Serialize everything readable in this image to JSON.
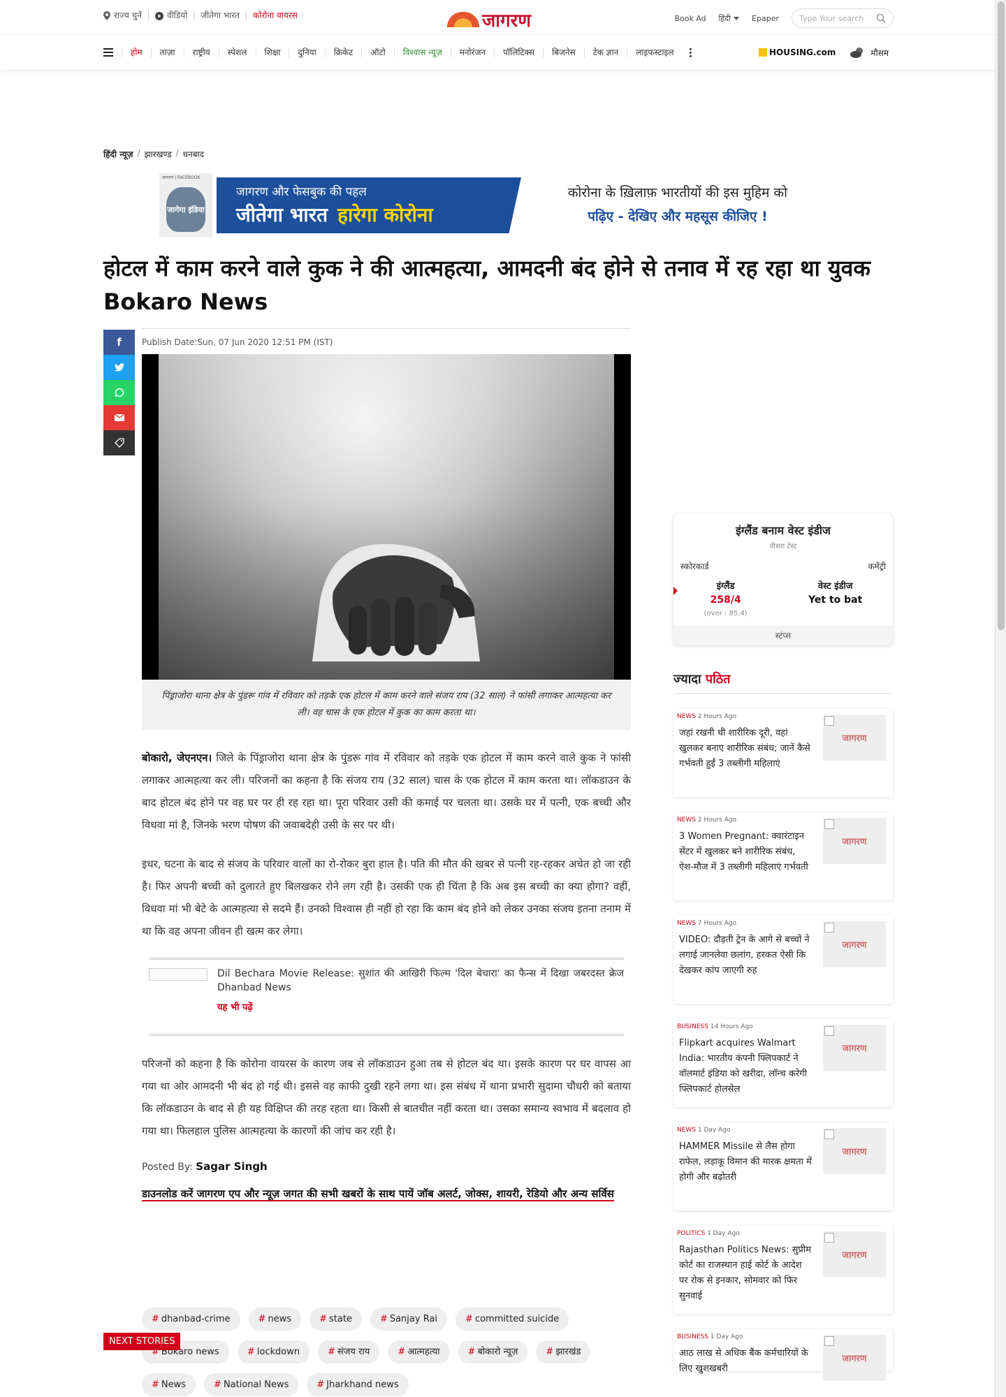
{
  "topbar": {
    "links": [
      {
        "label": "राज्य चुनें",
        "icon": "location-pin-icon"
      },
      {
        "label": "वीडियो",
        "icon": "play-circle-icon"
      },
      {
        "label": "जीतेगा भारत",
        "icon": ""
      },
      {
        "label": "कोरोना वायरस",
        "icon": ""
      }
    ],
    "logo_text": "जागरण",
    "book_ad": "Book Ad",
    "language": "हिंदी",
    "epaper": "Epaper",
    "search_placeholder": "Type Your search"
  },
  "nav": {
    "items": [
      "होम",
      "ताज़ा",
      "राष्ट्रीय",
      "स्पेशल",
      "शिक्षा",
      "दुनिया",
      "क्रिकेट",
      "ऑटो",
      "विश्वास न्यूज़",
      "मनोरंजन",
      "पॉलिटिक्स",
      "बिजनेस",
      "टेक ज्ञान",
      "लाइफस्टाइल"
    ],
    "housing": "HOUSING.com",
    "weather": "मौसम"
  },
  "breadcrumb": [
    "हिंदी न्यूज़",
    "झारखण्ड",
    "धनबाद"
  ],
  "banner": {
    "small_label": "जागरण | FACEBOOK",
    "map_text": "जागेगा इंडिया",
    "line1": "जागरण और फेसबुक की पहल",
    "line2a": "जीतेगा भारत",
    "line2b": "हारेगा कोरोना",
    "right1": "कोरोना के ख़िलाफ़ भारतीयों की इस मुहिम को",
    "right2": "पढ़िए - देखिए और महसूस कीजिए !"
  },
  "article": {
    "headline": "होटल में काम करने वाले कुक ने की आत्महत्या, आमदनी बंद होने से तनाव में रह रहा था युवक Bokaro News",
    "publish_date": "Publish Date:Sun, 07 Jun 2020 12:51 PM (IST)",
    "caption": "पिंड्राजोरा थाना क्षेत्र के पुंडरू गांव में रविवार को तड़के एक होटल में काम करने वाले संजय राय (32 साल) ने फांसी लगाकर आत्महत्या कर ली। वह चास के एक होटल में कुक का काम करता था।",
    "dateline": "बोकारो, जेएनएन।",
    "para1": " जिले के पिंड्राजोरा थाना क्षेत्र के पुंडरू गांव में रविवार को तड़के एक होटल में काम करने वाले कुक ने फांसी लगाकर आत्महत्या कर ली। परिजनों का कहना है कि संजय राय (32 साल) चास के एक होटल में काम करता था। लॉकडाउन के बाद होटल बंद होने पर वह घर पर ही रह रहा था। पूरा परिवार उसी की कमाई पर चलता था। उसके घर में पत्नी, एक बच्ची और विधवा मां है, जिनके भरण पोषण की जवाबदेही उसी के सर पर थी।",
    "para2": "इधर, घटना के बाद से संजय के परिवार वालों का रो-रोकर बुरा हाल है। पति की मौत की खबर से पत्नी रह-रहकर अचेत हो जा रही है। फिर अपनी बच्ची को दुलारते हुए बिलखकर रोने लग रही है। उसकी एक ही चिंता है कि अब इस बच्ची का क्या होगा? वहीं, विधवा मां भी बेटे के आत्महत्या से सदमे हैं। उनको विश्वास ही नहीं हो रहा कि काम बंद होने को लेकर उनका संजय इतना तनाम में था कि वह अपना जीवन ही खत्म कर लेगा।",
    "related_title": "Dil Bechara Movie Release: सुशांत की आखिरी फिल्म 'दिल बेचारा' का फैन्स में दिखा जबरदस्त क्रेज Dhanbad News",
    "related_more": "यह भी पढ़ें",
    "para3": "परिजनों को कहना है कि कोरोना वायरस के कारण जब से लॉकडाउन हुआ तब से होटल बंद था। इसके कारण पर घर वापस आ गया था ओर आमदनी भी बंद हो गई थी। इससे वह काफी दुखी रहने लगा था। इस संबंध में थाना प्रभारी सुदामा चौधरी को बताया कि लॉकडाउन के बाद से ही यह विक्षिप्त की तरह रहता था। किसी से बातचीत नहीं करता था। उसका समान्य स्वभाव में बदलाव हो गया था। फिलहाल पुलिस आत्महत्या के कारणों की जांच कर रही है।",
    "posted_label": "Posted By:",
    "posted_by": "Sagar Singh",
    "download_text": "डाउनलोड करें जागरण एप और न्यूज़ जगत की सभी खबरों के साथ पायें जॉब अलर्ट, जोक्स, शायरी, रेडियो और अन्य सर्विस"
  },
  "tags": [
    "dhanbad-crime",
    "news",
    "state",
    "Sanjay Rai",
    "committed suicide",
    "Bokaro news",
    "lockdown",
    "संजय राय",
    "आत्महत्या",
    "बोकारो न्यूज़",
    "झारखंड",
    "News",
    "National News",
    "Jharkhand news"
  ],
  "next_stories": "NEXT STORIES",
  "cricket": {
    "title": "इंग्लैंड बनाम वेस्ट इंडीज",
    "subtitle": "तीसरा टेस्ट",
    "scorecard": "स्कोरकार्ड",
    "commentary": "कमेंट्री",
    "team1": "इंग्लैंड",
    "score1": "258/4",
    "overs1": "(over : 85.4)",
    "team2": "वेस्ट इंडीज",
    "score2": "Yet to bat",
    "footer": "स्टंप्स"
  },
  "most_read": {
    "title_a": "ज्यादा",
    "title_b": "पठित",
    "items": [
      {
        "cat": "NEWS",
        "time": "2 Hours Ago",
        "title": "जहां रखनी थी शारीरिक दूरी, वहां खुलकर बनाए शारीरिक संबंध; जानें कैसे गर्भवती हुईं 3 तब्लीगी महिलाएं"
      },
      {
        "cat": "NEWS",
        "time": "2 Hours Ago",
        "title": "3 Women Pregnant: क्वारंटाइन सेंटर में खुलकर बने शारीरिक संबंध, ऐश-मौज में 3 तब्लीगी महिलाएं गर्भवती"
      },
      {
        "cat": "NEWS",
        "time": "7 Hours Ago",
        "title": "VIDEO: दौड़ती ट्रेन के आगे से बच्चों ने लगाई जानलेवा छलांग, हरकत ऐसी कि देखकर कांप जाएगी रुह"
      },
      {
        "cat": "BUSINESS",
        "time": "14 Hours Ago",
        "title": "Flipkart acquires Walmart India: भारतीय कंपनी फ्लिपकार्ट ने वॉलमार्ट इंडिया को खरीदा, लॉन्च करेगी फ्लिपकार्ट होलसेल"
      },
      {
        "cat": "NEWS",
        "time": "1 Day Ago",
        "title": "HAMMER Missile से लैस होगा राफेल, लड़ाकू विमान की मारक क्षमता में होगी और बढ़ोतरी"
      },
      {
        "cat": "POLITICS",
        "time": "1 Day Ago",
        "title": "Rajasthan Politics News: सुप्रीम कोर्ट का राजस्थान हाई कोर्ट के आदेश पर रोक से इनकार, सोमवार को फिर सुनवाई"
      },
      {
        "cat": "BUSINESS",
        "time": "1 Day Ago",
        "title": "आठ लाख से अधिक बैंक कर्मचारियों के लिए खुशखबरी"
      }
    ],
    "thumb_label": "जागरण"
  }
}
